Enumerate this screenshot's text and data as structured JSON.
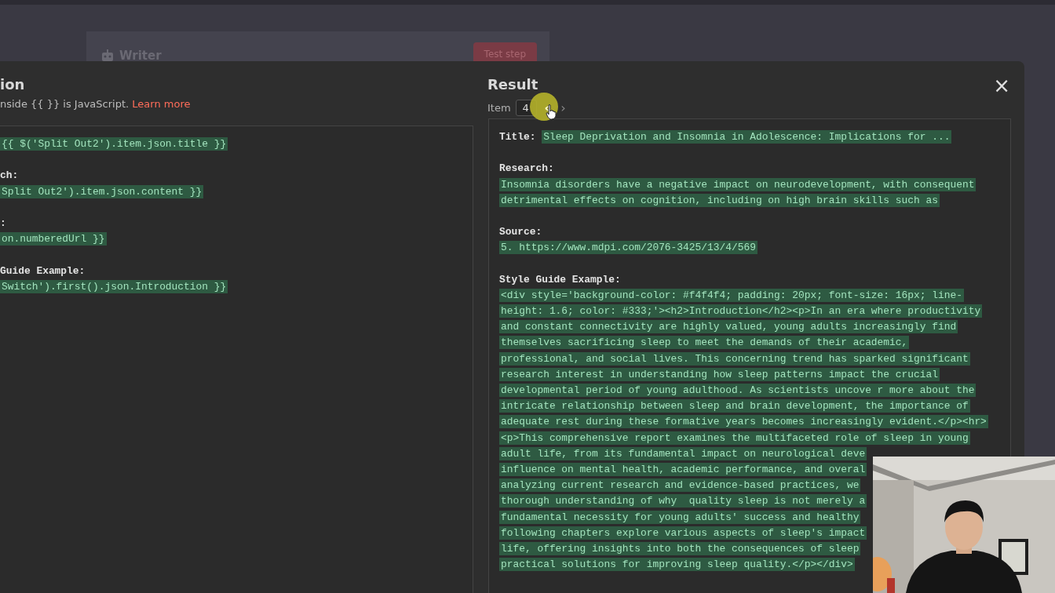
{
  "backdrop": {
    "node_title": "Writer",
    "test_button": "Test step"
  },
  "expression": {
    "title": "ion",
    "hint": "nside {{  }} is JavaScript.",
    "learn_more": "Learn more",
    "fields": [
      {
        "value_lines": [
          "{{ $('Split Out2').item.json.title }}"
        ]
      },
      {
        "label": "ch:",
        "inline": false,
        "value_lines": [
          "Split Out2').item.json.content }}"
        ]
      },
      {
        "label": ":",
        "inline": false,
        "value_lines": [
          "on.numberedUrl }}"
        ]
      },
      {
        "label": "Guide Example:",
        "inline": false,
        "value_lines": [
          "Switch').first().json.Introduction }}"
        ]
      }
    ]
  },
  "result": {
    "title": "Result",
    "item_label": "Item",
    "item_value": "4",
    "prev": "‹",
    "next": "›",
    "close": "×",
    "fields": [
      {
        "label": "Title:",
        "inline": true,
        "value_lines": [
          "Sleep Deprivation and Insomnia in Adolescence: Implications for ..."
        ]
      },
      {
        "label": "Research:",
        "inline": false,
        "value_lines": [
          "Insomnia disorders have a negative impact on neurodevelopment, with consequent",
          "detrimental effects on cognition, including on high brain skills such as"
        ]
      },
      {
        "label": "Source:",
        "inline": false,
        "value_lines": [
          "5. https://www.mdpi.com/2076-3425/13/4/569"
        ]
      },
      {
        "label": "Style Guide Example:",
        "inline": false,
        "value_lines": [
          "<div style='background-color: #f4f4f4; padding: 20px; font-size: 16px; line-",
          "height: 1.6; color: #333;'><h2>Introduction</h2><p>In an era where productivity",
          "and constant connectivity are highly valued, young adults increasingly find",
          "themselves sacrificing sleep to meet the demands of their academic,",
          "professional, and social lives. This concerning trend has sparked significant",
          "research interest in understanding how sleep patterns impact the crucial",
          "developmental period of young adulthood. As scientists uncove r more about the",
          "intricate relationship between sleep and brain development, the importance of",
          "adequate rest during these formative years becomes increasingly evident.</p><hr>",
          "<p>This comprehensive report examines the multifaceted role of sleep in young",
          "adult life, from its fundamental impact on neurological deve",
          "influence on mental health, academic performance, and overal",
          "analyzing current research and evidence-based practices, we",
          "thorough understanding of why  quality sleep is not merely a",
          "fundamental necessity for young adults' success and healthy",
          "following chapters explore various aspects of sleep's impact",
          "life, offering insights into both the consequences of sleep",
          "practical solutions for improving sleep quality.</p></div>"
        ]
      }
    ]
  }
}
